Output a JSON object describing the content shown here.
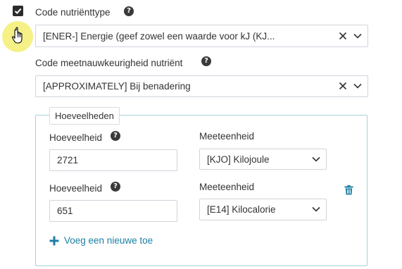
{
  "checkbox": {
    "checked": true
  },
  "nutrient_type": {
    "label": "Code nutriënttype",
    "help": "?",
    "value": "[ENER-] Energie (geef zowel een waarde voor kJ (KJ..."
  },
  "precision": {
    "label": "Code meetnauwkeurigheid nutriënt",
    "help": "?",
    "value": "[APPROXIMATELY] Bij benadering"
  },
  "quantities": {
    "legend": "Hoeveelheden",
    "rows": [
      {
        "amount_label": "Hoeveelheid",
        "help": "?",
        "amount": "2721",
        "unit_label": "Meeteenheid",
        "unit": "[KJO] Kilojoule"
      },
      {
        "amount_label": "Hoeveelheid",
        "help": "?",
        "amount": "651",
        "unit_label": "Meeteenheid",
        "unit": "[E14] Kilocalorie"
      }
    ],
    "add_label": "Voeg een nieuwe toe"
  },
  "colors": {
    "accent": "#1b7fa3",
    "cursor_highlight": "#f5f07a"
  }
}
